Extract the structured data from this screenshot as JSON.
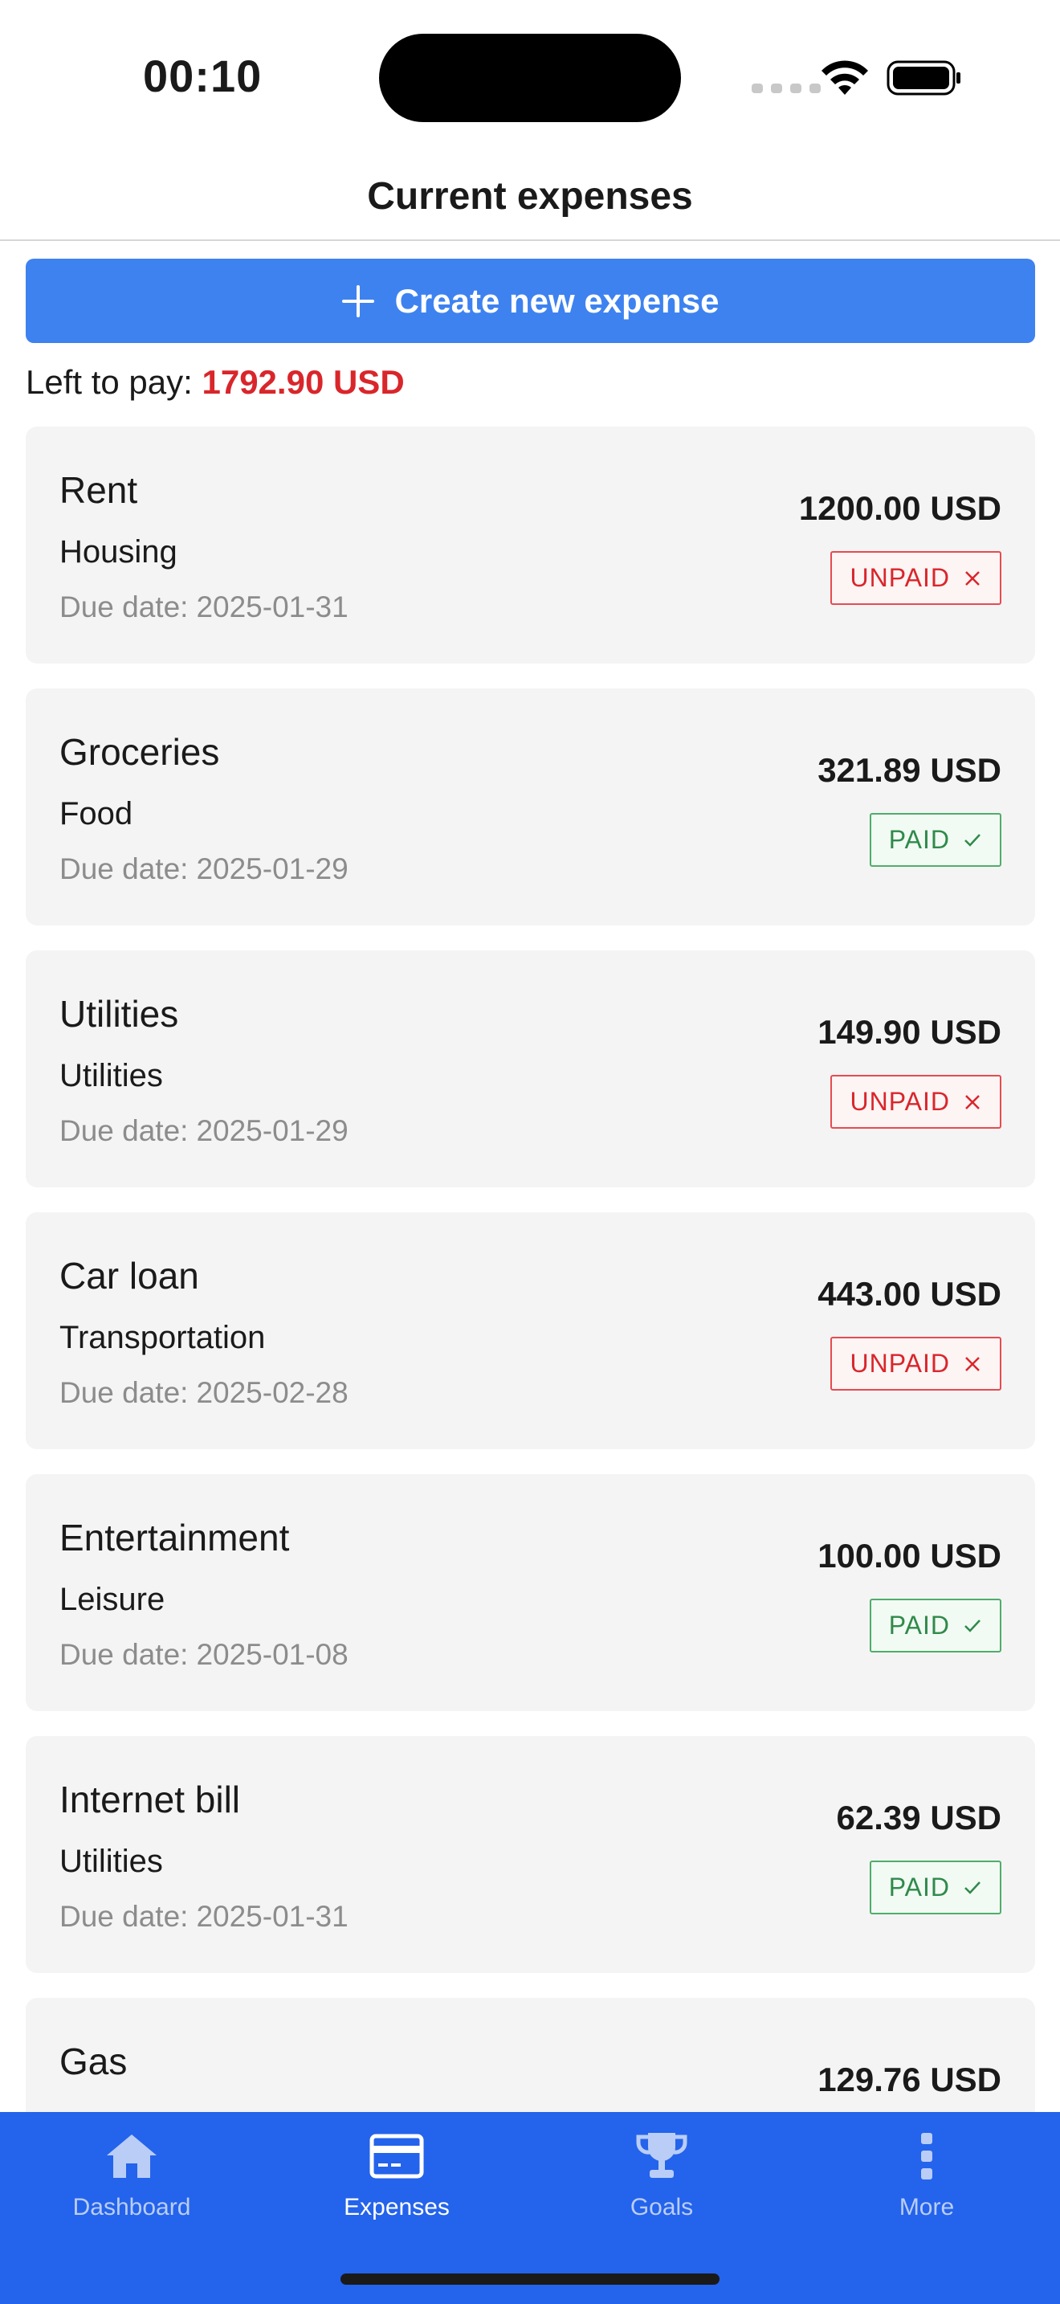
{
  "status_bar": {
    "time": "00:10"
  },
  "header": {
    "title": "Current expenses"
  },
  "create_button": {
    "label": "Create new expense"
  },
  "summary": {
    "label": "Left to pay:",
    "amount": "1792.90 USD",
    "amount_color": "#d9262b"
  },
  "expenses": [
    {
      "name": "Rent",
      "category": "Housing",
      "due_label": "Due date:",
      "due_date": "2025-01-31",
      "amount": "1200.00 USD",
      "status": "UNPAID"
    },
    {
      "name": "Groceries",
      "category": "Food",
      "due_label": "Due date:",
      "due_date": "2025-01-29",
      "amount": "321.89 USD",
      "status": "PAID"
    },
    {
      "name": "Utilities",
      "category": "Utilities",
      "due_label": "Due date:",
      "due_date": "2025-01-29",
      "amount": "149.90 USD",
      "status": "UNPAID"
    },
    {
      "name": "Car loan",
      "category": "Transportation",
      "due_label": "Due date:",
      "due_date": "2025-02-28",
      "amount": "443.00 USD",
      "status": "UNPAID"
    },
    {
      "name": "Entertainment",
      "category": "Leisure",
      "due_label": "Due date:",
      "due_date": "2025-01-08",
      "amount": "100.00 USD",
      "status": "PAID"
    },
    {
      "name": "Internet bill",
      "category": "Utilities",
      "due_label": "Due date:",
      "due_date": "2025-01-31",
      "amount": "62.39 USD",
      "status": "PAID"
    },
    {
      "name": "Gas",
      "category": "",
      "due_label": "",
      "due_date": "",
      "amount": "129.76 USD",
      "status": ""
    }
  ],
  "bottom_nav": {
    "items": [
      {
        "label": "Dashboard",
        "icon": "home-icon",
        "active": false
      },
      {
        "label": "Expenses",
        "icon": "credit-card-icon",
        "active": true
      },
      {
        "label": "Goals",
        "icon": "trophy-icon",
        "active": false
      },
      {
        "label": "More",
        "icon": "more-vertical-icon",
        "active": false
      }
    ]
  },
  "colors": {
    "accent": "#3e82f0",
    "nav_background": "#2463eb",
    "unpaid": "#d9262b",
    "paid": "#2f8a4a"
  }
}
